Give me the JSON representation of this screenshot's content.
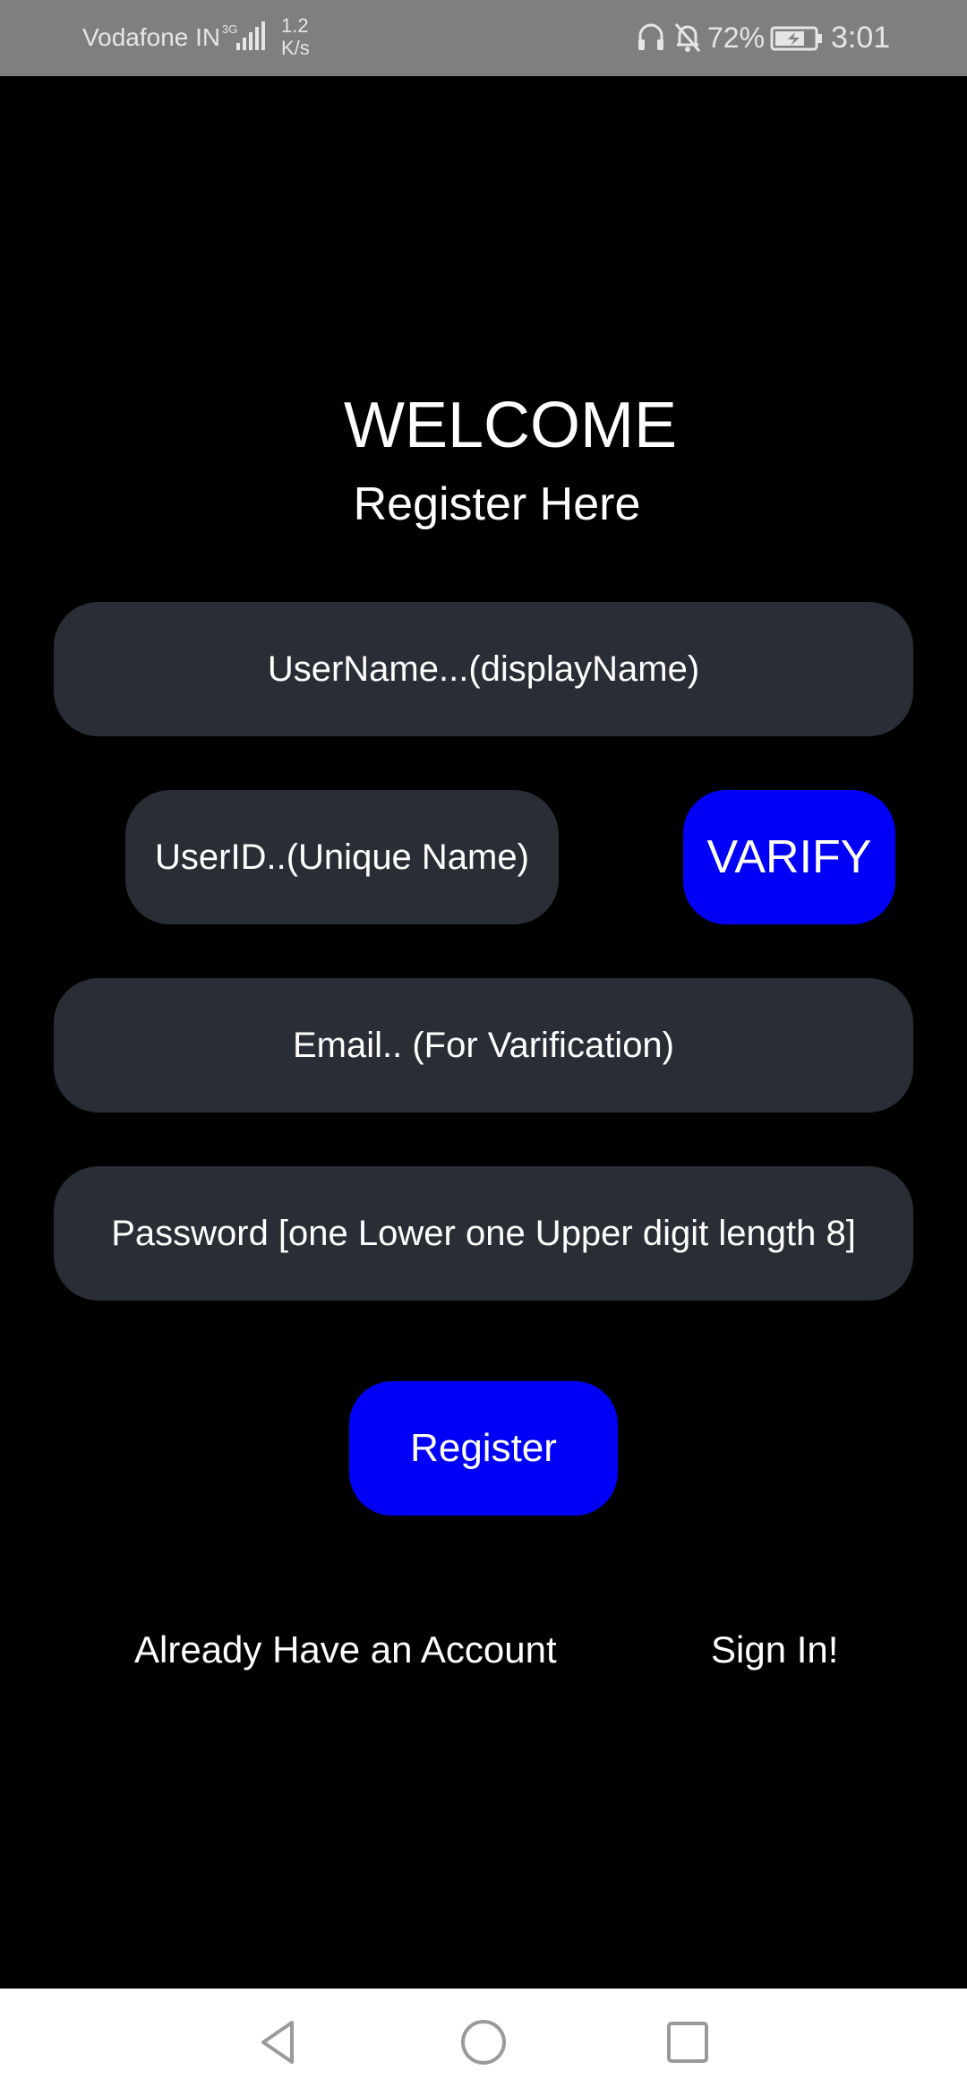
{
  "status_bar": {
    "carrier": "Vodafone IN",
    "network_type": "3G",
    "speed_value": "1.2",
    "speed_unit": "K/s",
    "battery_percent": "72%",
    "time": "3:01",
    "icons": [
      "signal-icon",
      "headset-icon",
      "mute-bell-icon",
      "battery-charging-icon"
    ]
  },
  "header": {
    "title": "WELCOME",
    "subtitle": "Register Here"
  },
  "form": {
    "username_placeholder": "UserName...(displayName)",
    "userid_placeholder": "UserID..(Unique Name)",
    "verify_label": "VARIFY",
    "email_placeholder": "Email..  (For Varification)",
    "password_placeholder": "Password  [one Lower one Upper digit length 8]",
    "register_label": "Register"
  },
  "footer": {
    "already_account": "Already Have an Account",
    "sign_in": "Sign In!"
  },
  "nav_bar": {
    "icons": [
      "back-icon",
      "home-icon",
      "recents-icon"
    ]
  },
  "colors": {
    "background": "#000000",
    "status_bar": "#7f7f7f",
    "field_bg": "#292d36",
    "accent_blue": "#0000f7",
    "text": "#ffffff",
    "nav_bar": "#ffffff"
  }
}
